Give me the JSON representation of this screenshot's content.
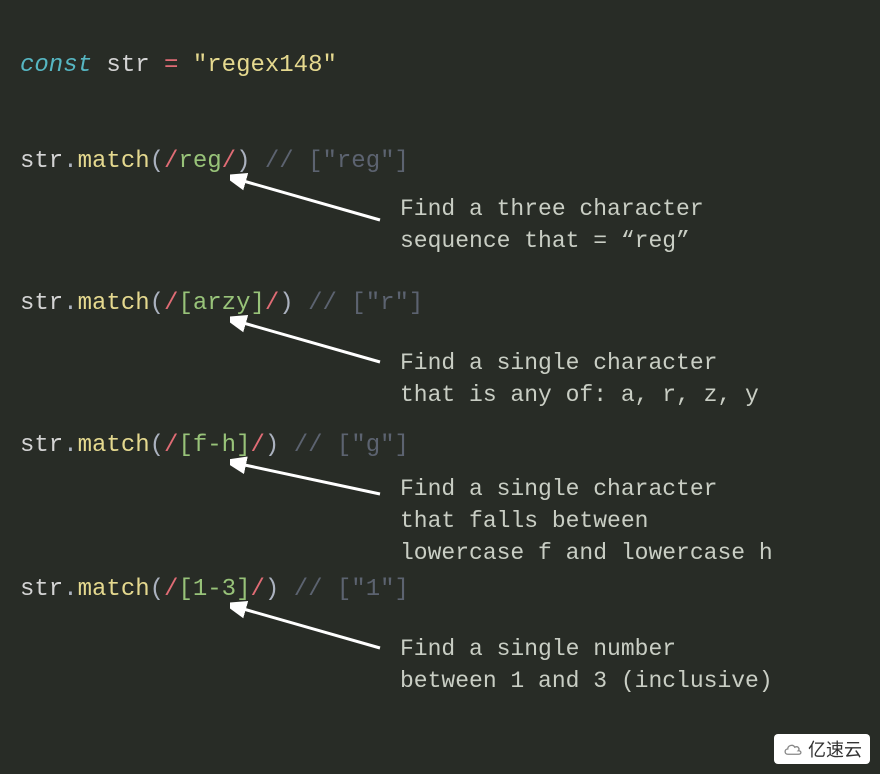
{
  "declaration": {
    "keyword": "const",
    "ident": "str",
    "eq": "=",
    "value": "\"regex148\""
  },
  "examples": [
    {
      "obj": "str",
      "dot": ".",
      "method": "match",
      "open": "(",
      "regex_open": "/",
      "regex_body": "reg",
      "regex_close": "/",
      "close": ")",
      "comment": "// [\"reg\"]",
      "annotation_l1": "Find a three character",
      "annotation_l2": "sequence that = “reg”"
    },
    {
      "obj": "str",
      "dot": ".",
      "method": "match",
      "open": "(",
      "regex_open": "/",
      "regex_body": "[arzy]",
      "regex_close": "/",
      "close": ")",
      "comment": "// [\"r\"]",
      "annotation_l1": "Find a single character",
      "annotation_l2": "that is any of: a, r, z, y"
    },
    {
      "obj": "str",
      "dot": ".",
      "method": "match",
      "open": "(",
      "regex_open": "/",
      "regex_body": "[f-h]",
      "regex_close": "/",
      "close": ")",
      "comment": "// [\"g\"]",
      "annotation_l1": "Find a single character",
      "annotation_l2": "that falls between",
      "annotation_l3": "lowercase f and lowercase h"
    },
    {
      "obj": "str",
      "dot": ".",
      "method": "match",
      "open": "(",
      "regex_open": "/",
      "regex_body": "[1-3]",
      "regex_close": "/",
      "close": ")",
      "comment": "// [\"1\"]",
      "annotation_l1": "Find a single number",
      "annotation_l2": "between 1 and 3 (inclusive)"
    }
  ],
  "watermark_text": "亿速云"
}
